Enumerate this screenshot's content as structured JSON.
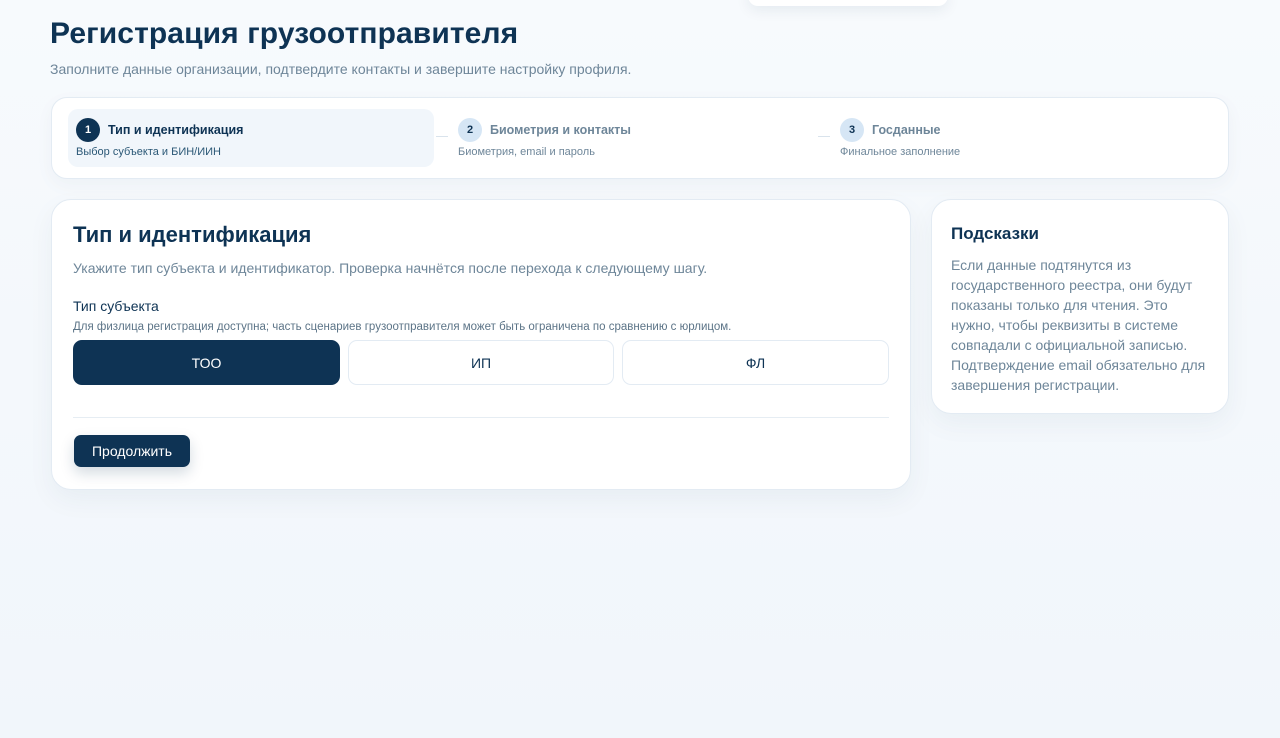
{
  "header": {
    "title": "Регистрация грузоотправителя",
    "subtitle": "Заполните данные организации, подтвердите контакты и завершите настройку профиля."
  },
  "stepper": {
    "steps": [
      {
        "number": "1",
        "title": "Тип и идентификация",
        "description": "Выбор субъекта и БИН/ИИН",
        "active": true
      },
      {
        "number": "2",
        "title": "Биометрия и контакты",
        "description": "Биометрия, email и пароль",
        "active": false
      },
      {
        "number": "3",
        "title": "Госданные",
        "description": "Финальное заполнение",
        "active": false
      }
    ]
  },
  "form": {
    "title": "Тип и идентификация",
    "description": "Укажите тип субъекта и идентификатор. Проверка начнётся после перехода к следующему шагу.",
    "subject_type": {
      "label": "Тип субъекта",
      "hint": "Для физлица регистрация доступна; часть сценариев грузоотправителя может быть ограничена по сравнению с юрлицом.",
      "options": [
        "ТОО",
        "ИП",
        "ФЛ"
      ],
      "selected": "ТОО"
    },
    "continue_label": "Продолжить"
  },
  "hints": {
    "title": "Подсказки",
    "text": "Если данные подтянутся из государственного реестра, они будут показаны только для чтения. Это нужно, чтобы реквизиты в системе совпадали с официальной записью. Подтверждение email обязательно для завершения регистрации."
  },
  "colors": {
    "primary": "#0e3354",
    "muted": "#6e8699",
    "step_badge": "#d6e6f5",
    "active_step_bg": "#f1f6fb",
    "background": "#f4f8fc"
  }
}
